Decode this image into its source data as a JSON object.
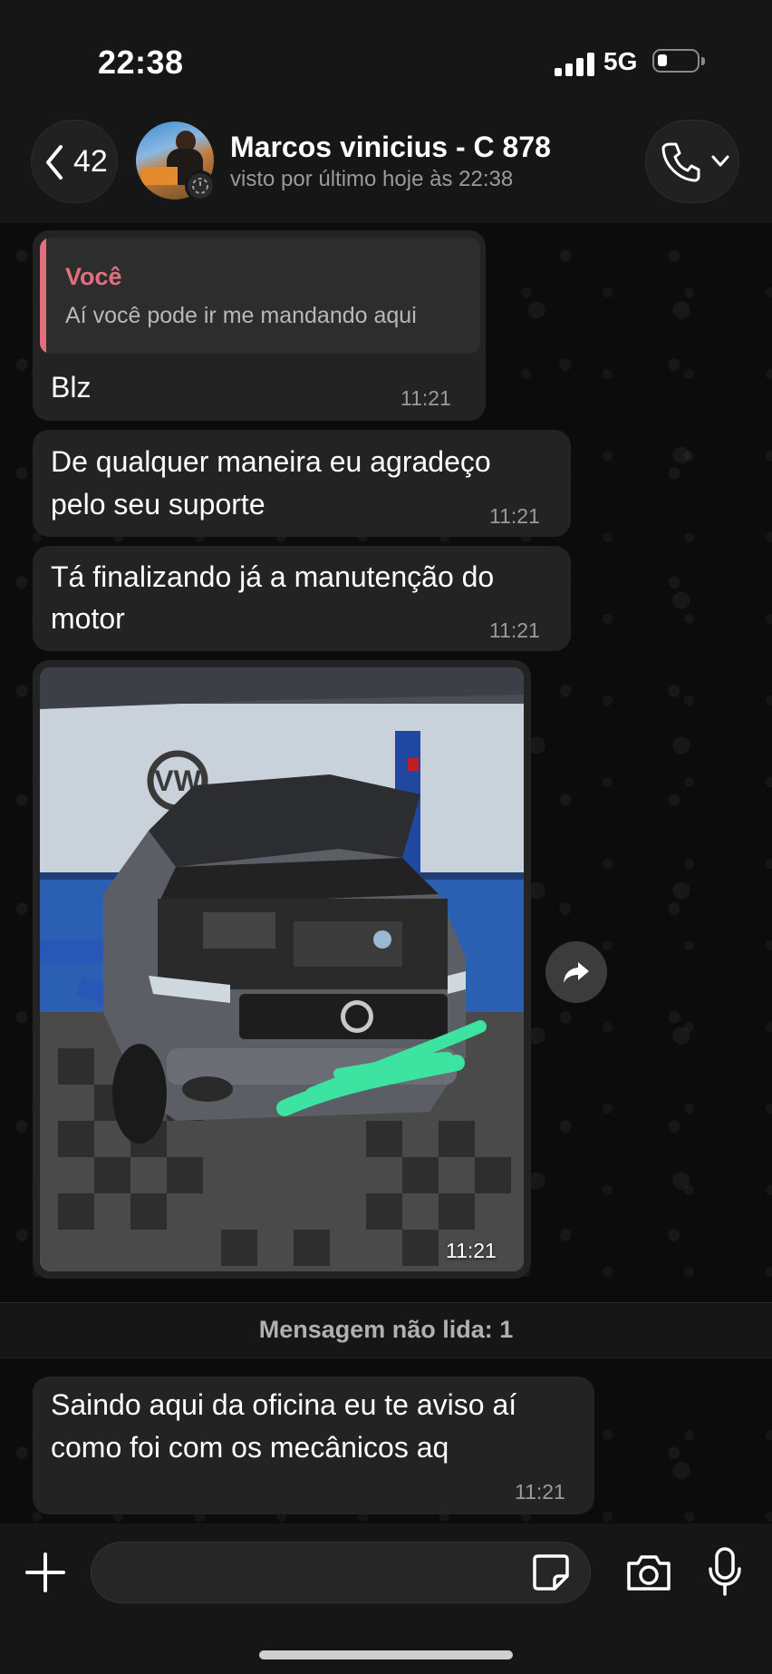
{
  "status_bar": {
    "time": "22:38",
    "network": "5G"
  },
  "header": {
    "back_count": "42",
    "contact_name": "Marcos vinicius - C 878",
    "last_seen": "visto por último hoje às 22:38"
  },
  "messages": [
    {
      "quote_author": "Você",
      "quote_text": "Aí você pode ir me mandando aqui",
      "lines": [
        "Blz"
      ],
      "time": "11:21"
    },
    {
      "lines": [
        "De qualquer maneira eu agradeço",
        "pelo seu suporte"
      ],
      "time": "11:21"
    },
    {
      "lines": [
        "Tá finalizando já a manutenção do",
        "motor"
      ],
      "time": "11:21"
    },
    {
      "type": "image",
      "time": "11:21"
    }
  ],
  "unread_divider": "Mensagem não lida: 1",
  "unread_messages": [
    {
      "lines": [
        "Saindo aqui da oficina eu te aviso aí",
        "como foi com os mecânicos aq"
      ],
      "time": "11:21"
    }
  ],
  "icons": {
    "back": "chevron-left-icon",
    "call": "phone-icon",
    "call_menu": "chevron-down-icon",
    "forward": "forward-arrow-icon",
    "add": "plus-icon",
    "sticker": "sticker-icon",
    "camera": "camera-icon",
    "mic": "microphone-icon"
  },
  "colors": {
    "background": "#0b0b0b",
    "bar": "#161616",
    "bubble": "#232323",
    "quote_accent": "#e36f7d",
    "timestamp": "#9b9b9b"
  }
}
